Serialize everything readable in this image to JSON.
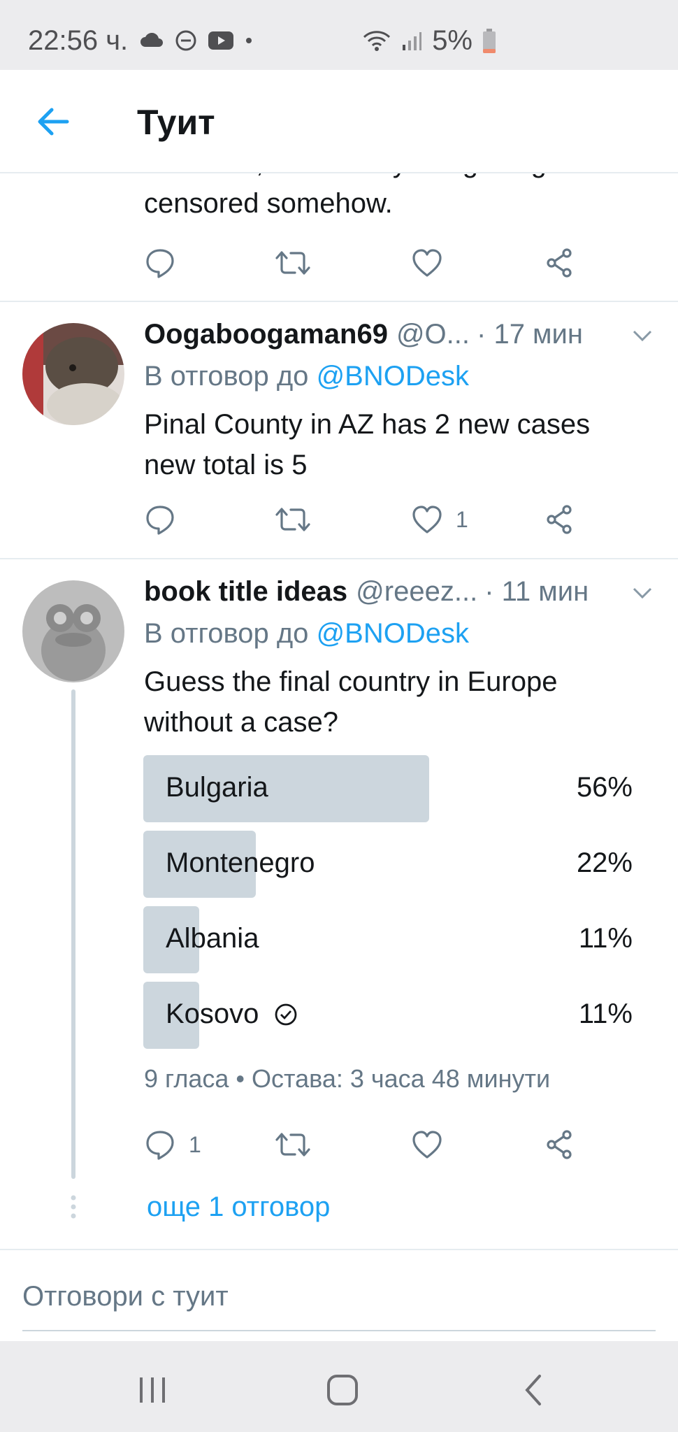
{
  "status_bar": {
    "time": "22:56 ч.",
    "battery": "5%",
    "icons": [
      "cloud-icon",
      "dnd-icon",
      "youtube-icon",
      "dot-icon",
      "wifi-icon",
      "signal-icon",
      "battery-icon"
    ]
  },
  "header": {
    "title": "Туит",
    "back_icon": "arrow-left-icon"
  },
  "partial_tweet": {
    "text_line1": "first case, I think they are getting",
    "text_line2": "censored somehow."
  },
  "tweets": [
    {
      "name": "Oogaboogaman69",
      "handle": "@O...",
      "time": "· 17 мин",
      "reply_prefix": "В отговор до",
      "reply_to": "@BNODesk",
      "body_line1": "Pinal County in AZ has 2 new cases",
      "body_line2": "new total is 5",
      "reply_count": "",
      "like_count": "1"
    },
    {
      "name": "book title ideas",
      "handle": "@reeez...",
      "time": "· 11 мин",
      "reply_prefix": "В отговор до",
      "reply_to": "@BNODesk",
      "body_line1": "Guess the final country in Europe",
      "body_line2": "without a case?",
      "reply_count": "1",
      "like_count": "",
      "poll": {
        "options": [
          {
            "label": "Bulgaria",
            "percent": "56%",
            "fraction": 0.56,
            "selected": false
          },
          {
            "label": "Montenegro",
            "percent": "22%",
            "fraction": 0.22,
            "selected": false
          },
          {
            "label": "Albania",
            "percent": "11%",
            "fraction": 0.11,
            "selected": false
          },
          {
            "label": "Kosovo",
            "percent": "11%",
            "fraction": 0.11,
            "selected": true
          }
        ],
        "meta": "9 гласа • Остава: 3 часа 48 минути"
      },
      "more_replies": "още 1 отговор"
    }
  ],
  "reply_bar": {
    "placeholder": "Отговори с туит"
  },
  "colors": {
    "accent": "#1da1f2",
    "secondary_text": "#657786",
    "poll_fill": "#ccd6dd",
    "divider": "#e6ecf0"
  }
}
